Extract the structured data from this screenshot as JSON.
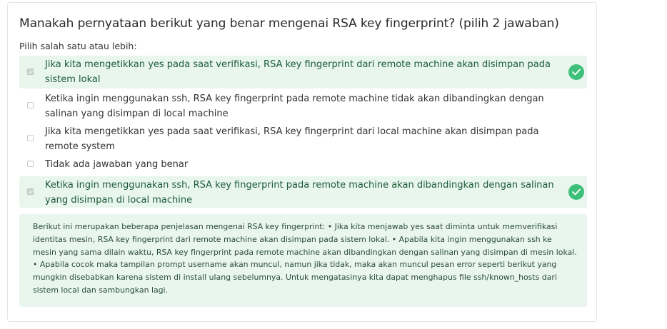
{
  "question": {
    "text": "Manakah pernyataan berikut yang benar mengenai RSA key fingerprint? (pilih 2 jawaban)",
    "instruction": "Pilih salah satu atau lebih:"
  },
  "options": [
    {
      "text": "Jika kita mengetikkan yes pada saat verifikasi, RSA key fingerprint dari remote machine akan disimpan pada sistem lokal",
      "checked": true,
      "correct": true
    },
    {
      "text": "Ketika ingin menggunakan ssh, RSA key fingerprint pada remote machine tidak akan dibandingkan dengan salinan yang disimpan di local machine",
      "checked": false,
      "correct": false
    },
    {
      "text": "Jika kita mengetikkan yes pada saat verifikasi, RSA key fingerprint dari local machine akan disimpan pada remote system",
      "checked": false,
      "correct": false
    },
    {
      "text": "Tidak ada jawaban yang benar",
      "checked": false,
      "correct": false
    },
    {
      "text": "Ketika ingin menggunakan ssh, RSA key fingerprint pada remote machine akan dibandingkan dengan salinan yang disimpan di local machine",
      "checked": true,
      "correct": true
    }
  ],
  "feedback": {
    "text": "Berikut ini merupakan beberapa penjelasan mengenai RSA key fingerprint: • Jika kita menjawab yes saat diminta untuk memverifikasi identitas mesin, RSA key fingerprint dari remote machine akan disimpan pada sistem lokal. • Apabila kita ingin menggunakan ssh ke mesin yang sama dilain waktu, RSA key fingerprint pada remote machine akan dibandingkan dengan salinan yang disimpan di mesin lokal. • Apabila cocok maka tampilan prompt username akan muncul, namun jika tidak, maka akan muncul pesan error seperti berikut yang mungkin disebabkan karena sistem di install ulang sebelumnya. Untuk mengatasinya kita dapat menghapus file ssh/known_hosts dari sistem local dan sambungkan lagi."
  },
  "colors": {
    "correct_bg": "#e8f6ee",
    "check_badge": "#3ec07a",
    "correct_text": "#1d5a38"
  }
}
